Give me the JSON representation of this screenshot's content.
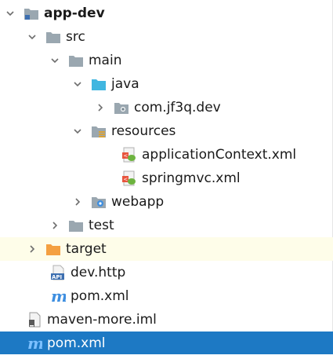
{
  "tree": {
    "root": "app-dev",
    "src": "src",
    "main": "main",
    "java": "java",
    "package": "com.jf3q.dev",
    "resources": "resources",
    "appctx": "applicationContext.xml",
    "springmvc": "springmvc.xml",
    "webapp": "webapp",
    "test": "test",
    "target": "target",
    "devhttp": "dev.http",
    "pom_inner": "pom.xml",
    "iml": "maven-more.iml",
    "pom_root": "pom.xml",
    "api_badge": "API",
    "maven_glyph": "m"
  },
  "colors": {
    "selection": "#1d79c4",
    "highlight": "#fefde9",
    "folder_gray": "#9aa7b0",
    "folder_blue": "#40b6e0",
    "folder_orange": "#f4a041",
    "maven_blue": "#3d8ee0"
  },
  "icons": {
    "folder": "folder-icon",
    "module": "module-folder-icon",
    "source_root": "source-folder-icon",
    "resources_root": "resources-folder-icon",
    "package": "package-icon",
    "web": "web-folder-icon",
    "excluded": "excluded-folder-icon",
    "xml": "spring-xml-icon",
    "http": "http-file-icon",
    "maven": "maven-icon",
    "iml": "iml-file-icon"
  }
}
